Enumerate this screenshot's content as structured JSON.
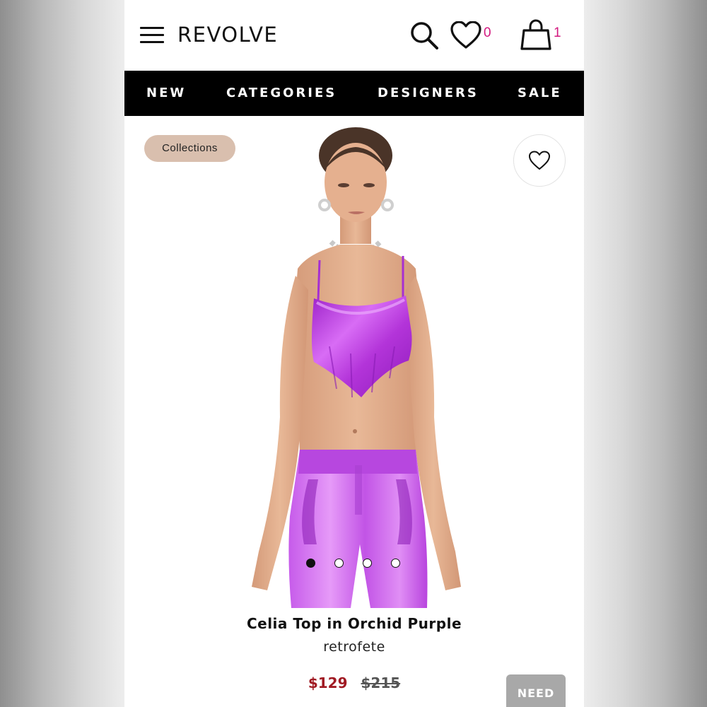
{
  "header": {
    "logo": "REVOLVE",
    "wishlist_count": "0",
    "bag_count": "1"
  },
  "nav": {
    "items": [
      "NEW",
      "CATEGORIES",
      "DESIGNERS",
      "SALE"
    ]
  },
  "badge": {
    "label": "Collections"
  },
  "product": {
    "name": "Celia Top in Orchid Purple",
    "brand": "retrofete",
    "sale_price": "$129",
    "original_price": "$215",
    "image_count": 4,
    "active_image": 1
  },
  "help": {
    "label": "NEED HELP?"
  },
  "colors": {
    "accent_pink": "#d3187f",
    "sale_red": "#a01a23",
    "badge_bg": "#d9bfae",
    "product_purple": "#b334d9",
    "nav_bg": "#000000"
  },
  "icons": [
    "menu-icon",
    "search-icon",
    "heart-icon",
    "bag-icon",
    "heart-outline-icon"
  ]
}
